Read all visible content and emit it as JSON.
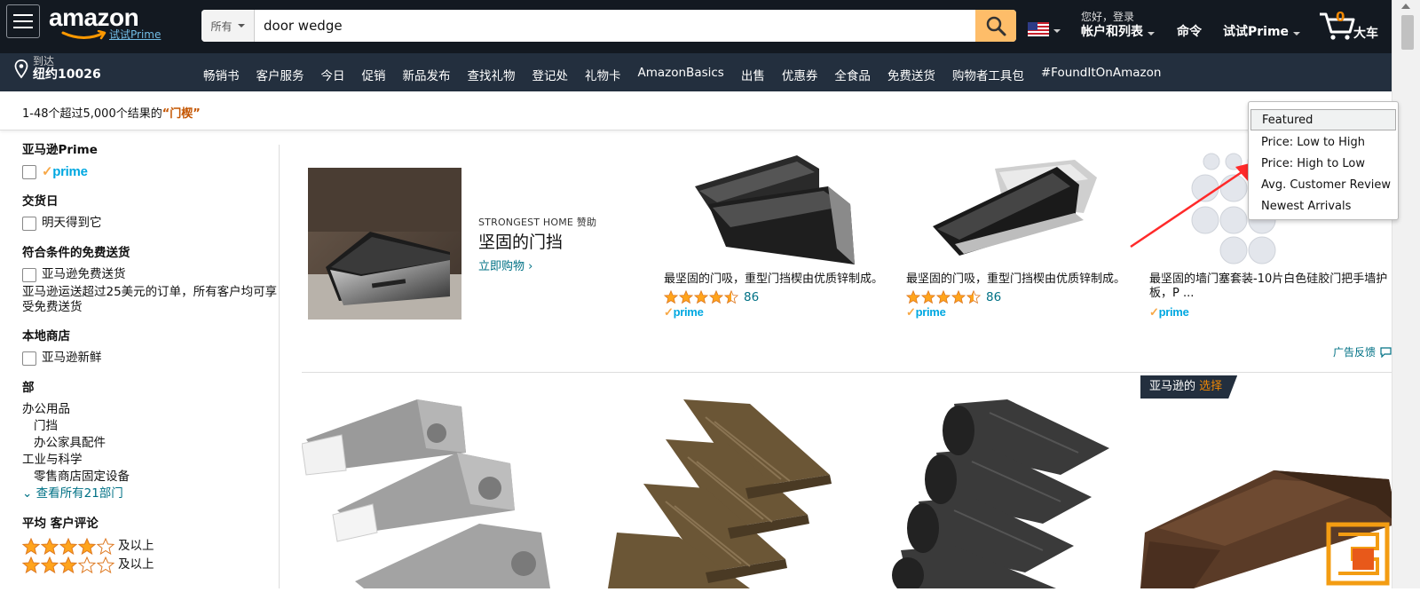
{
  "header": {
    "logo_text": "amazon",
    "logo_prime": "试试Prime",
    "search": {
      "category": "所有",
      "query": "door wedge"
    },
    "account": {
      "greeting": "您好，登录",
      "label": "帐户和列表"
    },
    "orders": "命令",
    "prime": "试试Prime",
    "cart": {
      "count": "0",
      "label": "大车"
    },
    "deliver": {
      "small": "到达",
      "big": "纽约10026"
    },
    "nav_links": [
      "畅销书",
      "客户服务",
      "今日",
      "促销",
      "新品发布",
      "查找礼物",
      "登记处",
      "礼物卡",
      "AmazonBasics",
      "出售",
      "优惠券",
      "全食品",
      "免费送货",
      "购物者工具包",
      "#FoundItOnAmazon"
    ]
  },
  "results": {
    "prefix": "1-48个超过5,000个结果的",
    "query": "“门楔”"
  },
  "sort_dropdown": {
    "options": [
      "Featured",
      "Price: Low to High",
      "Price: High to Low",
      "Avg. Customer Review",
      "Newest Arrivals"
    ]
  },
  "sidebar": {
    "prime_title": "亚马逊Prime",
    "prime_badge": "prime",
    "delivery_title": "交货日",
    "delivery_option": "明天得到它",
    "free_ship_title": "符合条件的免费送货",
    "free_ship_option": "亚马逊免费送货",
    "free_ship_note": "亚马逊运送超过25美元的订单，所有客户均可享受免费送货",
    "local_title": "本地商店",
    "local_option": "亚马逊新鲜",
    "dept_title": "部",
    "departments": [
      "办公用品",
      "门挡",
      "办公家具配件",
      "工业与科学",
      "零售商店固定设备"
    ],
    "see_all": "查看所有21部门",
    "review_title": "平均 客户评论",
    "review_suffix": "及以上",
    "review_levels": [
      4,
      3
    ]
  },
  "sponsored": {
    "brand": "STRONGEST HOME 赞助",
    "headline": "坚固的门挡",
    "shop_now": "立即购物 ›",
    "items": [
      {
        "title": "最坚固的门吸，重型门挡楔由优质锌制成。",
        "rating": 4.5,
        "count": "86",
        "prime": "prime"
      },
      {
        "title": "最坚固的门吸，重型门挡楔由优质锌制成。",
        "rating": 4.5,
        "count": "86",
        "prime": "prime"
      },
      {
        "title": "最坚固的墙门塞套装-10片白色硅胶门把手墙护板，P ...",
        "prime": "prime"
      }
    ],
    "ad_feedback": "广告反馈"
  },
  "choice_badge": {
    "prefix": "亚马逊的",
    "highlight": "选择"
  },
  "colors": {
    "header_bg": "#131921",
    "subnav_bg": "#232f3e",
    "search_button": "#febd69",
    "link": "#007185",
    "prime_blue": "#00a8e1",
    "accent_orange": "#f08804",
    "query_orange": "#c45500",
    "star": "#ffa41c"
  }
}
